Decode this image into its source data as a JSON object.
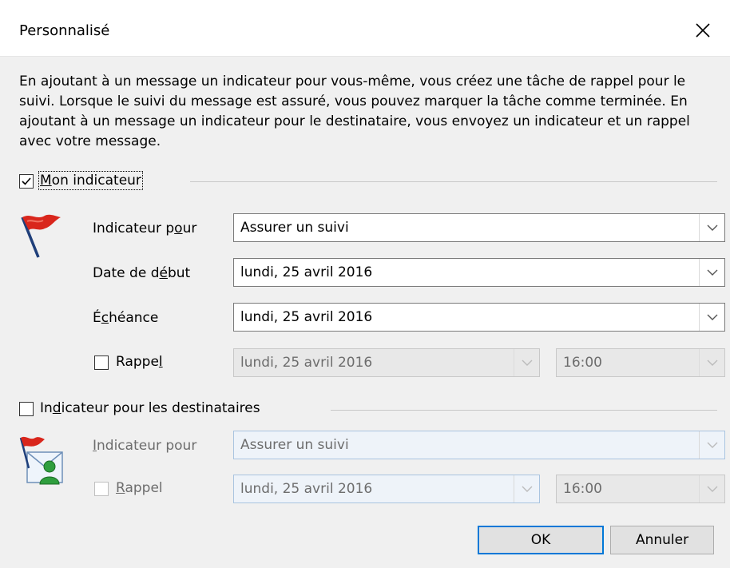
{
  "dialog": {
    "title": "Personnalisé",
    "description": "En ajoutant à un message un indicateur pour vous-même, vous créez une tâche de rappel pour le suivi. Lorsque le suivi du message est assuré, vous pouvez marquer la tâche comme terminée. En ajoutant à un message un indicateur pour le destinataire, vous envoyez un indicateur et un rappel avec votre message."
  },
  "my_flag": {
    "checkbox_checked": true,
    "label": {
      "pre": "",
      "key": "M",
      "post": "on indicateur"
    },
    "flag_for_label": {
      "pre": "Indicateur p",
      "key": "o",
      "post": "ur"
    },
    "flag_for_value": "Assurer un suivi",
    "start_date_label": {
      "pre": "Date de d",
      "key": "é",
      "post": "but"
    },
    "start_date_value": "lundi, 25 avril 2016",
    "due_date_label": {
      "pre": "É",
      "key": "c",
      "post": "héance"
    },
    "due_date_value": "lundi, 25 avril 2016",
    "reminder_checked": false,
    "reminder_label": {
      "pre": "Rappe",
      "key": "l",
      "post": ""
    },
    "reminder_date": "lundi, 25 avril 2016",
    "reminder_time": "16:00"
  },
  "recipients_flag": {
    "checkbox_checked": false,
    "label": {
      "pre": "In",
      "key": "d",
      "post": "icateur pour les destinataires"
    },
    "flag_for_label": {
      "pre": "",
      "key": "I",
      "post": "ndicateur pour"
    },
    "flag_for_value": "Assurer un suivi",
    "reminder_checked": false,
    "reminder_label": {
      "pre": "",
      "key": "R",
      "post": "appel"
    },
    "reminder_date": "lundi, 25 avril 2016",
    "reminder_time": "16:00"
  },
  "buttons": {
    "ok": "OK",
    "cancel": "Annuler"
  },
  "colors": {
    "flag_red": "#d9261c",
    "focus_blue": "#0078d7",
    "disabled_text": "#6d6d6d"
  },
  "icons": [
    "close-icon",
    "red-flag-icon",
    "contact-flag-icon",
    "chevron-down-icon",
    "checkmark-icon"
  ]
}
